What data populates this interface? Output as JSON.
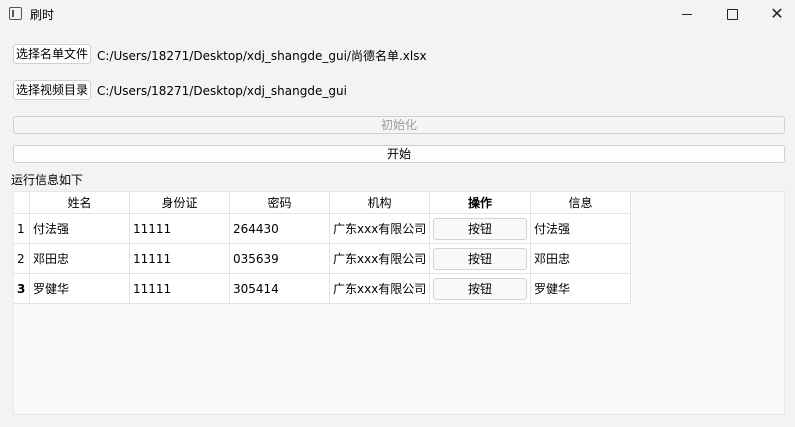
{
  "window": {
    "title": "刷时",
    "close_glyph": "✕"
  },
  "controls": {
    "select_list_button": "选择名单文件",
    "list_path": "C:/Users/18271/Desktop/xdj_shangde_gui/尚德名单.xlsx",
    "select_video_button": "选择视频目录",
    "video_path": "C:/Users/18271/Desktop/xdj_shangde_gui",
    "init_button": "初始化",
    "start_button": "开始"
  },
  "log_label": "运行信息如下",
  "table": {
    "headers": [
      "姓名",
      "身份证",
      "密码",
      "机构",
      "操作",
      "信息"
    ],
    "rows": [
      {
        "num": "1",
        "name": "付法强",
        "id": "11111",
        "password": "264430",
        "org": "广东xxx有限公司",
        "action": "按钮",
        "info": "付法强"
      },
      {
        "num": "2",
        "name": "邓田忠",
        "id": "11111",
        "password": "035639",
        "org": "广东xxx有限公司",
        "action": "按钮",
        "info": "邓田忠"
      },
      {
        "num": "3",
        "name": "罗健华",
        "id": "11111",
        "password": "305414",
        "org": "广东xxx有限公司",
        "action": "按钮",
        "info": "罗健华"
      }
    ]
  }
}
